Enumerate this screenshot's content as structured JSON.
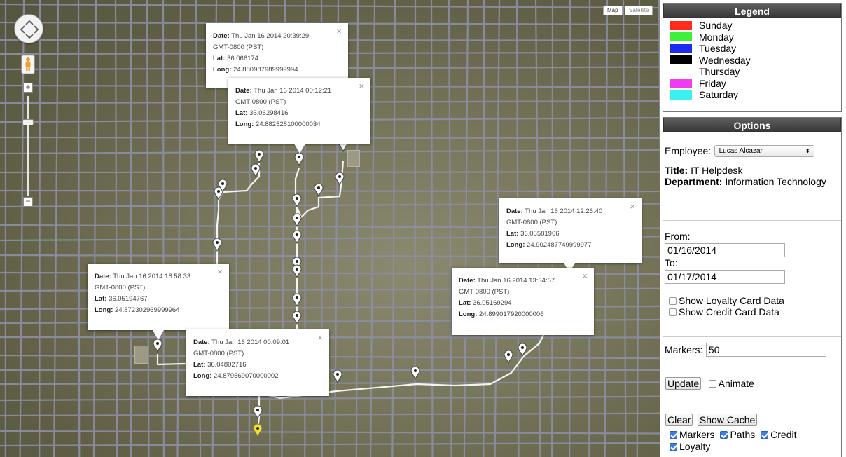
{
  "map": {
    "type_buttons": [
      {
        "label": "Map",
        "active": true
      },
      {
        "label": "Satellite",
        "active": false
      }
    ],
    "controls": {
      "pan_icon": "pan-arrows-icon",
      "street_view_icon": "pegman-icon",
      "zoom_in": "+",
      "zoom_out": "−"
    },
    "info_windows": [
      {
        "date_label": "Date:",
        "date": "Thu Jan 16 2014 20:39:29",
        "tz": "GMT-0800 (PST)",
        "lat_label": "Lat:",
        "lat": "36.066174",
        "long_label": "Long:",
        "long": "24.880987989999994"
      },
      {
        "date_label": "Date:",
        "date": "Thu Jan 16 2014 00:12:21",
        "tz": "GMT-0800 (PST)",
        "lat_label": "Lat:",
        "lat": "36.06298416",
        "long_label": "Long:",
        "long": "24.882528100000034"
      },
      {
        "date_label": "Date:",
        "date": "Thu Jan 16 2014 12:26:40",
        "tz": "GMT-0800 (PST)",
        "lat_label": "Lat:",
        "lat": "36.05581966",
        "long_label": "Long:",
        "long": "24.902487749999977"
      },
      {
        "date_label": "Date:",
        "date": "Thu Jan 16 2014 18:58:33",
        "tz": "GMT-0800 (PST)",
        "lat_label": "Lat:",
        "lat": "36.05194767",
        "long_label": "Long:",
        "long": "24.872302969999964"
      },
      {
        "date_label": "Date:",
        "date": "Thu Jan 16 2014 13:34:57",
        "tz": "GMT-0800 (PST)",
        "lat_label": "Lat:",
        "lat": "36.05169294",
        "long_label": "Long:",
        "long": "24.899017920000006"
      },
      {
        "date_label": "Date:",
        "date": "Thu Jan 16 2014 00:09:01",
        "tz": "GMT-0800 (PST)",
        "lat_label": "Lat:",
        "lat": "36.04802716",
        "long_label": "Long:",
        "long": "24.879569070000002"
      }
    ],
    "close_glyph": "×"
  },
  "legend": {
    "title": "Legend",
    "items": [
      {
        "label": "Sunday",
        "color": "#ff2b1c"
      },
      {
        "label": "Monday",
        "color": "#3cf03c"
      },
      {
        "label": "Tuesday",
        "color": "#1a2cf0"
      },
      {
        "label": "Wednesday",
        "color": "#000000"
      },
      {
        "label": "Thursday",
        "color": "#ffffff"
      },
      {
        "label": "Friday",
        "color": "#f03cf0"
      },
      {
        "label": "Saturday",
        "color": "#3cf0f0"
      }
    ]
  },
  "options": {
    "title": "Options",
    "employee_label": "Employee:",
    "employee_value": "Lucas Alcazar",
    "title_label": "Title:",
    "title_value": "IT Helpdesk",
    "department_label": "Department:",
    "department_value": "Information Technology",
    "from_label": "From:",
    "from_value": "01/16/2014",
    "to_label": "To:",
    "to_value": "01/17/2014",
    "show_loyalty": "Show Loyalty Card Data",
    "show_credit": "Show Credit Card Data",
    "markers_label": "Markers:",
    "markers_value": "50",
    "update_button": "Update",
    "animate_label": "Animate",
    "clear_button": "Clear",
    "show_cache_button": "Show Cache",
    "toggle_markers": "Markers",
    "toggle_paths": "Paths",
    "toggle_credit": "Credit",
    "toggle_loyalty": "Loyalty"
  }
}
